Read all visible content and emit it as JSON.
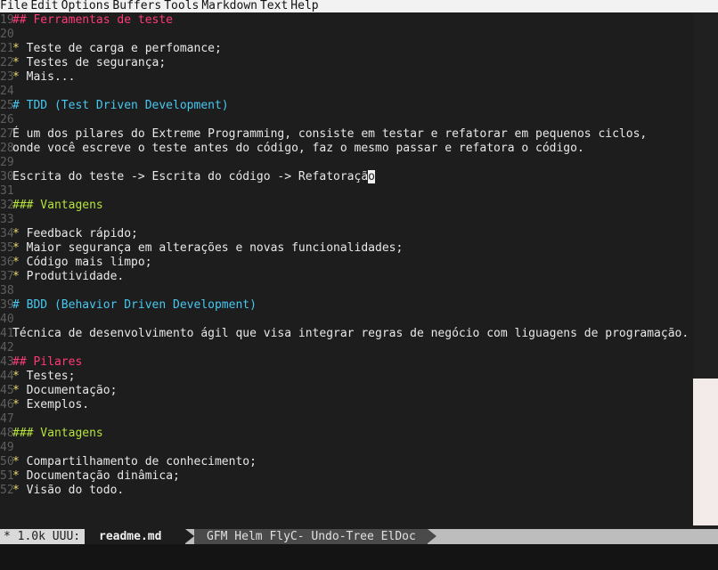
{
  "menu": [
    "File",
    "Edit",
    "Options",
    "Buffers",
    "Tools",
    "Markdown",
    "Text",
    "Help"
  ],
  "lines": [
    {
      "n": "19",
      "segs": [
        {
          "t": "## Ferramentas de teste",
          "c": "h2"
        }
      ]
    },
    {
      "n": "20",
      "segs": []
    },
    {
      "n": "21",
      "segs": [
        {
          "t": "* ",
          "c": "bullet"
        },
        {
          "t": "Teste de carga e perfomance;",
          "c": ""
        }
      ]
    },
    {
      "n": "22",
      "segs": [
        {
          "t": "* ",
          "c": "bullet"
        },
        {
          "t": "Testes de segurança;",
          "c": ""
        }
      ]
    },
    {
      "n": "23",
      "segs": [
        {
          "t": "* ",
          "c": "bullet"
        },
        {
          "t": "Mais...",
          "c": ""
        }
      ]
    },
    {
      "n": "24",
      "segs": []
    },
    {
      "n": "25",
      "segs": [
        {
          "t": "# TDD (Test Driven Development)",
          "c": "h1"
        }
      ]
    },
    {
      "n": "26",
      "segs": []
    },
    {
      "n": "27",
      "segs": [
        {
          "t": "É um dos pilares do Extreme Programming, consiste em testar e refatorar em pequenos ciclos,",
          "c": ""
        }
      ]
    },
    {
      "n": "28",
      "segs": [
        {
          "t": "onde você escreve o teste antes do código, faz o mesmo passar e refatora o código.",
          "c": ""
        }
      ]
    },
    {
      "n": "29",
      "segs": []
    },
    {
      "n": "30",
      "segs": [
        {
          "t": "Escrita do teste -> Escrita do código -> Refatoraçã",
          "c": ""
        },
        {
          "t": "o",
          "c": "cursor"
        }
      ]
    },
    {
      "n": "31",
      "segs": []
    },
    {
      "n": "32",
      "segs": [
        {
          "t": "### Vantagens",
          "c": "h3"
        }
      ]
    },
    {
      "n": "33",
      "segs": []
    },
    {
      "n": "34",
      "segs": [
        {
          "t": "* ",
          "c": "bullet"
        },
        {
          "t": "Feedback rápido;",
          "c": ""
        }
      ]
    },
    {
      "n": "35",
      "segs": [
        {
          "t": "* ",
          "c": "bullet"
        },
        {
          "t": "Maior segurança em alterações e novas funcionalidades;",
          "c": ""
        }
      ]
    },
    {
      "n": "36",
      "segs": [
        {
          "t": "* ",
          "c": "bullet"
        },
        {
          "t": "Código mais limpo;",
          "c": ""
        }
      ]
    },
    {
      "n": "37",
      "segs": [
        {
          "t": "* ",
          "c": "bullet"
        },
        {
          "t": "Produtividade.",
          "c": ""
        }
      ]
    },
    {
      "n": "38",
      "segs": []
    },
    {
      "n": "39",
      "segs": [
        {
          "t": "# BDD (Behavior Driven Development)",
          "c": "h1"
        }
      ]
    },
    {
      "n": "40",
      "segs": []
    },
    {
      "n": "41",
      "segs": [
        {
          "t": "Técnica de desenvolvimento ágil que visa integrar regras de negócio com liguagens de programação.",
          "c": ""
        }
      ]
    },
    {
      "n": "42",
      "segs": []
    },
    {
      "n": "43",
      "segs": [
        {
          "t": "## Pilares",
          "c": "h2"
        }
      ]
    },
    {
      "n": "44",
      "segs": [
        {
          "t": "* ",
          "c": "bullet"
        },
        {
          "t": "Testes;",
          "c": ""
        }
      ]
    },
    {
      "n": "45",
      "segs": [
        {
          "t": "* ",
          "c": "bullet"
        },
        {
          "t": "Documentação;",
          "c": ""
        }
      ]
    },
    {
      "n": "46",
      "segs": [
        {
          "t": "* ",
          "c": "bullet"
        },
        {
          "t": "Exemplos.",
          "c": ""
        }
      ]
    },
    {
      "n": "47",
      "segs": []
    },
    {
      "n": "48",
      "segs": [
        {
          "t": "### Vantagens",
          "c": "h3"
        }
      ]
    },
    {
      "n": "49",
      "segs": []
    },
    {
      "n": "50",
      "segs": [
        {
          "t": "* ",
          "c": "bullet"
        },
        {
          "t": "Compartilhamento de conhecimento;",
          "c": ""
        }
      ]
    },
    {
      "n": "51",
      "segs": [
        {
          "t": "* ",
          "c": "bullet"
        },
        {
          "t": "Documentação dinâmica;",
          "c": ""
        }
      ]
    },
    {
      "n": "52",
      "segs": [
        {
          "t": "* ",
          "c": "bullet"
        },
        {
          "t": "Visão do todo.",
          "c": ""
        }
      ]
    }
  ],
  "modeline": {
    "status": "* 1.0k UUU:",
    "filename": "readme.md",
    "modes": "GFM Helm FlyC- Undo-Tree ElDoc"
  }
}
